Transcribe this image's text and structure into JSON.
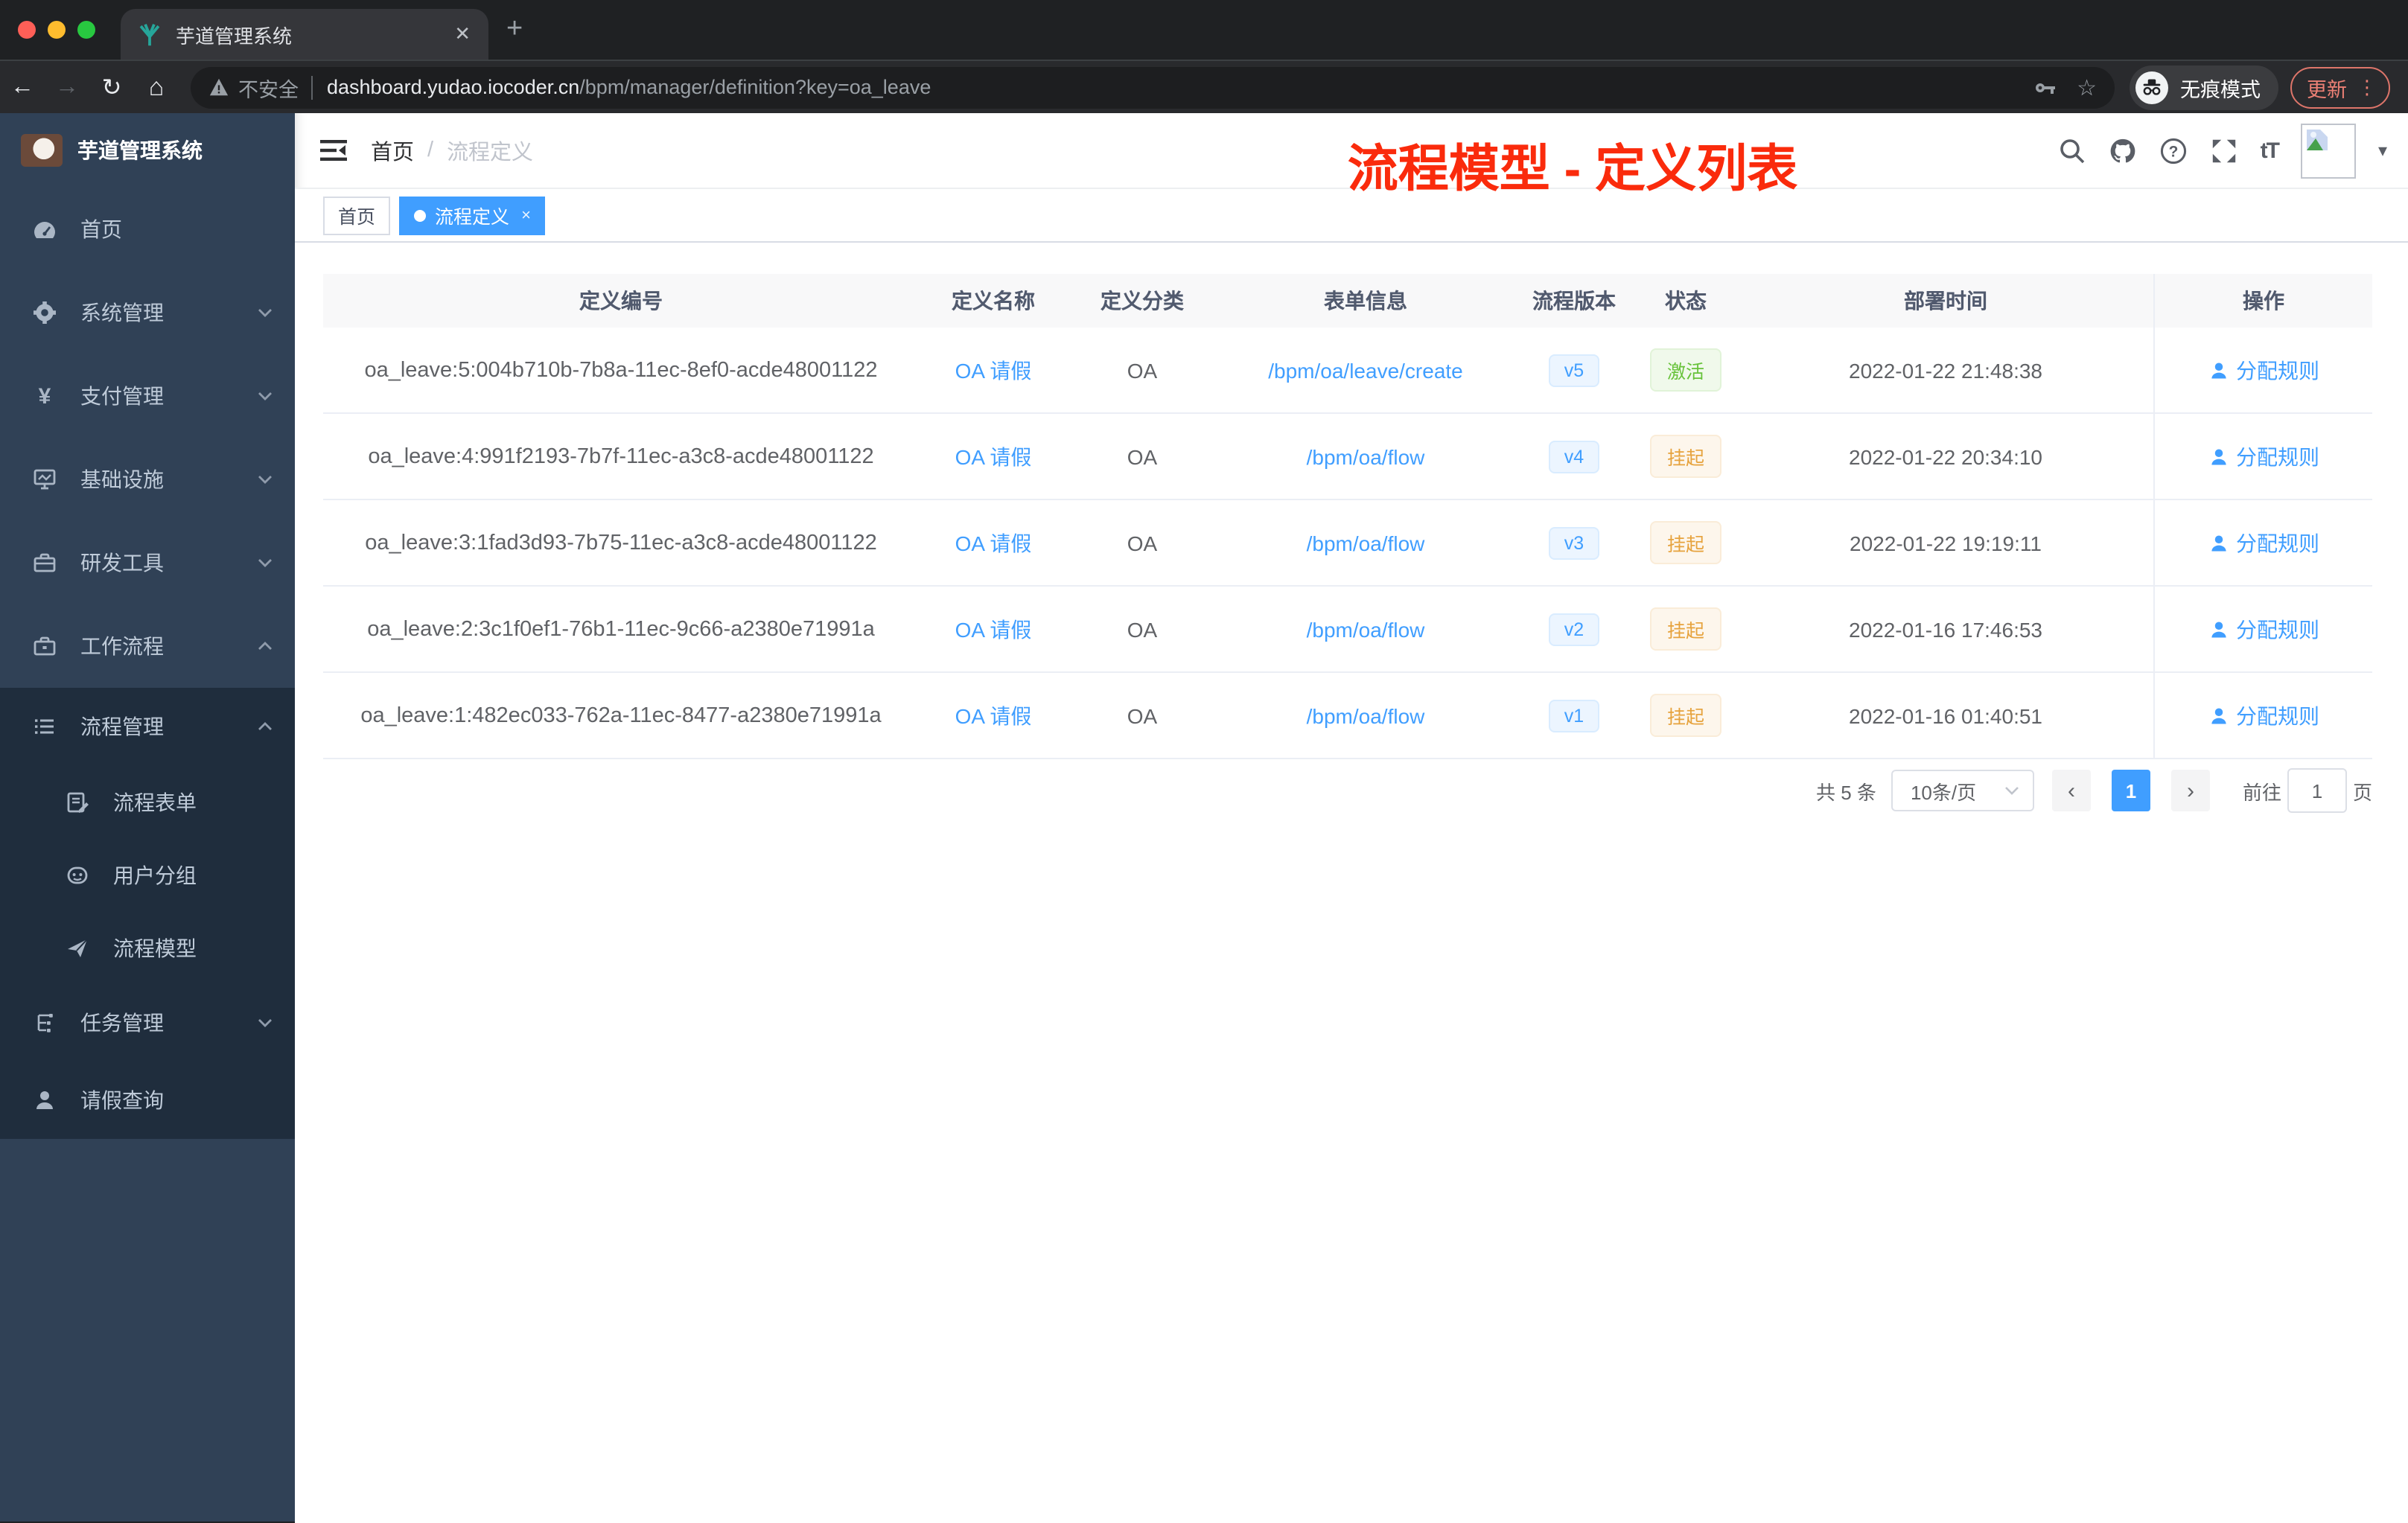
{
  "browser": {
    "tab_title": "芋道管理系统",
    "security_label": "不安全",
    "url_domain": "dashboard.yudao.iocoder.cn",
    "url_path": "/bpm/manager/definition?key=oa_leave",
    "incognito_label": "无痕模式",
    "update_label": "更新"
  },
  "sidebar": {
    "logo_title": "芋道管理系统",
    "items": [
      {
        "label": "首页"
      },
      {
        "label": "系统管理"
      },
      {
        "label": "支付管理"
      },
      {
        "label": "基础设施"
      },
      {
        "label": "研发工具"
      },
      {
        "label": "工作流程"
      }
    ],
    "workflow_menu": {
      "process_group": {
        "label": "流程管理",
        "children": [
          {
            "label": "流程表单"
          },
          {
            "label": "用户分组"
          },
          {
            "label": "流程模型"
          }
        ]
      },
      "task": {
        "label": "任务管理"
      },
      "leave_query": {
        "label": "请假查询"
      }
    }
  },
  "navbar": {
    "breadcrumb_home": "首页",
    "breadcrumb_sep": "/",
    "breadcrumb_current": "流程定义",
    "fontsize_label": "tT"
  },
  "annotation": {
    "text": "流程模型 - 定义列表",
    "color": "#fa2b0c"
  },
  "tags": {
    "home": "首页",
    "active": "流程定义"
  },
  "table": {
    "columns": [
      "定义编号",
      "定义名称",
      "定义分类",
      "表单信息",
      "流程版本",
      "状态",
      "部署时间",
      "操作"
    ],
    "rows": [
      {
        "id": "oa_leave:5:004b710b-7b8a-11ec-8ef0-acde48001122",
        "name": "OA 请假",
        "category": "OA",
        "form": "/bpm/oa/leave/create",
        "version": "v5",
        "status": {
          "label": "激活",
          "type": "success"
        },
        "deployed": "2022-01-22 21:48:38",
        "action": "分配规则"
      },
      {
        "id": "oa_leave:4:991f2193-7b7f-11ec-a3c8-acde48001122",
        "name": "OA 请假",
        "category": "OA",
        "form": "/bpm/oa/flow",
        "version": "v4",
        "status": {
          "label": "挂起",
          "type": "warning"
        },
        "deployed": "2022-01-22 20:34:10",
        "action": "分配规则"
      },
      {
        "id": "oa_leave:3:1fad3d93-7b75-11ec-a3c8-acde48001122",
        "name": "OA 请假",
        "category": "OA",
        "form": "/bpm/oa/flow",
        "version": "v3",
        "status": {
          "label": "挂起",
          "type": "warning"
        },
        "deployed": "2022-01-22 19:19:11",
        "action": "分配规则"
      },
      {
        "id": "oa_leave:2:3c1f0ef1-76b1-11ec-9c66-a2380e71991a",
        "name": "OA 请假",
        "category": "OA",
        "form": "/bpm/oa/flow",
        "version": "v2",
        "status": {
          "label": "挂起",
          "type": "warning"
        },
        "deployed": "2022-01-16 17:46:53",
        "action": "分配规则"
      },
      {
        "id": "oa_leave:1:482ec033-762a-11ec-8477-a2380e71991a",
        "name": "OA 请假",
        "category": "OA",
        "form": "/bpm/oa/flow",
        "version": "v1",
        "status": {
          "label": "挂起",
          "type": "warning"
        },
        "deployed": "2022-01-16 01:40:51",
        "action": "分配规则"
      }
    ]
  },
  "pagination": {
    "total_label": "共 5 条",
    "page_size": "10条/页",
    "current_page": "1",
    "goto_label": "前往",
    "goto_value": "1",
    "page_unit": "页"
  },
  "colors": {
    "accent": "#409eff",
    "success": "#67c23a",
    "warning": "#e6a23c",
    "annotation": "#fa2b0c"
  }
}
